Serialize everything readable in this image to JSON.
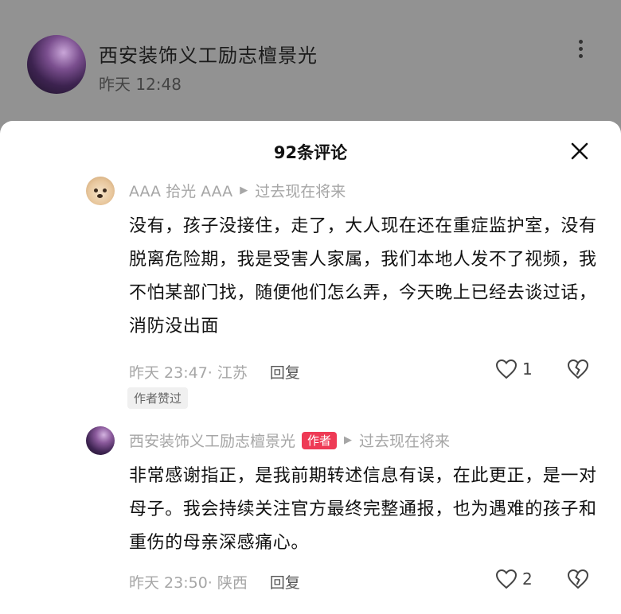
{
  "post": {
    "author": "西安装饰义工励志檀景光",
    "time": "昨天 12:48",
    "peek_text": "…."
  },
  "sheet": {
    "title": "92条评论"
  },
  "comments": [
    {
      "user": "AAA 拾光 AAA",
      "reply_to": "过去现在将来",
      "text": "没有，孩子没接住，走了，大人现在还在重症监护室，没有脱离危险期，我是受害人家属，我们本地人发不了视频，我不怕某部门找，随便他们怎么弄，今天晚上已经去谈过话，消防没出面",
      "time_loc": "昨天 23:47· 江苏",
      "reply_label": "回复",
      "likes": "1",
      "tag": "作者赞过"
    },
    {
      "user": "西安装饰义工励志檀景光",
      "badge": "作者",
      "reply_to": "过去现在将来",
      "text": "非常感谢指正，是我前期转述信息有误，在此更正，是一对母子。我会持续关注官方最终完整通报，也为遇难的孩子和重伤的母亲深感痛心。",
      "time_loc": "昨天 23:50· 陕西",
      "reply_label": "回复",
      "likes": "2"
    }
  ],
  "icons": {
    "close": "close-icon",
    "like": "heart-icon",
    "dislike": "broken-heart-icon",
    "more": "more-vertical-icon"
  },
  "colors": {
    "author_badge": "#ee3a55",
    "meta_gray": "#a6a6a6"
  }
}
